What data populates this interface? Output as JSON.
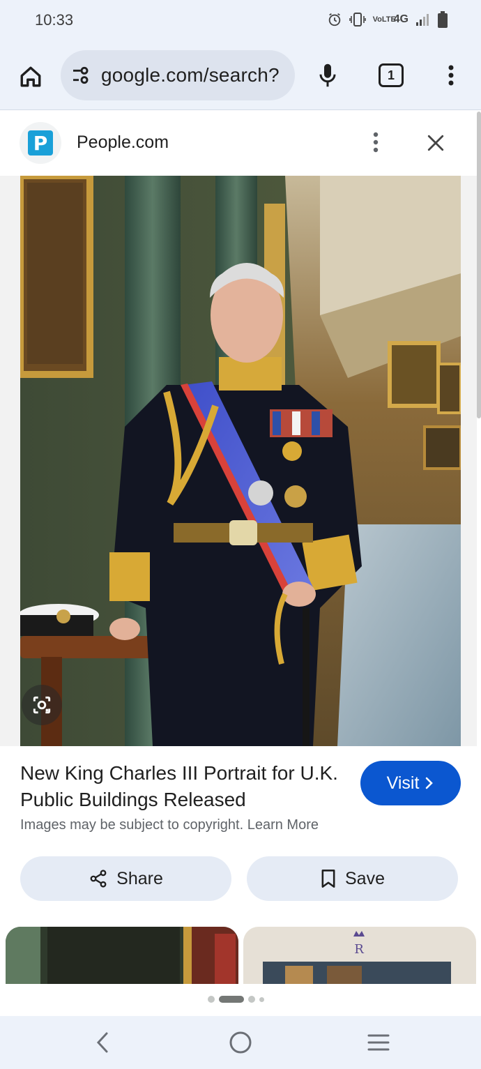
{
  "status_bar": {
    "time": "10:33",
    "network": "4G",
    "volte": "VoLTE"
  },
  "browser": {
    "url": "google.com/search?",
    "tab_count": "1",
    "icons": [
      "home-icon",
      "tune-icon",
      "mic-icon",
      "tab-switcher-icon",
      "more-vert-icon"
    ]
  },
  "source": {
    "favicon_letter": "P",
    "name": "People.com",
    "favicon_color": "#1aa0d8"
  },
  "result": {
    "title": "New King Charles III Portrait for U.K. Public Buildings Released",
    "visit_label": "Visit",
    "copyright_text": "Images may be subject to copyright. Learn More"
  },
  "actions": {
    "share_label": "Share",
    "save_label": "Save"
  },
  "colors": {
    "accent": "#0b57d0",
    "chrome_bg": "#edf2fa",
    "chip_bg": "#e5ebf5"
  },
  "pager": {
    "total": 4,
    "active_index": 1
  }
}
